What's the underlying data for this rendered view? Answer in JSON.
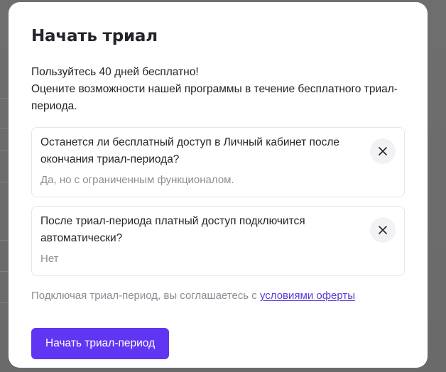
{
  "modal": {
    "title": "Начать триал",
    "intro_line1": "Пользуйтесь 40 дней бесплатно!",
    "intro_line2": "Оцените возможности нашей программы в течение бесплатного триал-периода.",
    "faq": [
      {
        "question": "Останется ли бесплатный доступ в Личный кабинет после окончания триал-периода?",
        "answer": "Да, но с ограниченным функционалом."
      },
      {
        "question": "После триал-периода платный доступ подключится автоматически?",
        "answer": "Нет"
      }
    ],
    "terms_prefix": "Подключая триал-период, вы соглашаетесь с ",
    "terms_link": "условиями оферты",
    "cta_label": "Начать триал-период"
  },
  "colors": {
    "accent": "#6136f3",
    "link": "#5b39d6",
    "text": "#24242b",
    "muted": "#8c8c94"
  },
  "icons": {
    "faq_close": "close-icon"
  }
}
